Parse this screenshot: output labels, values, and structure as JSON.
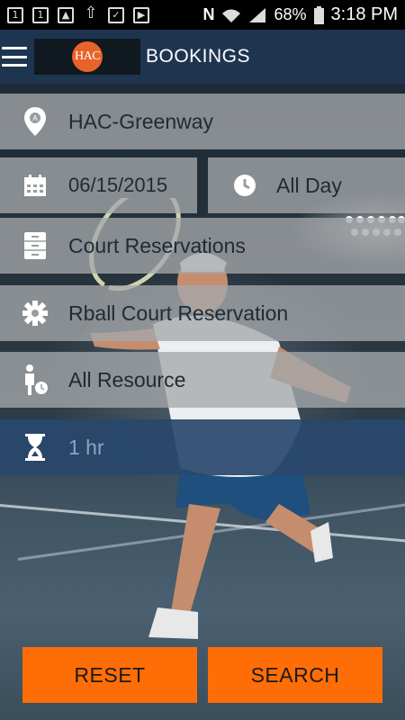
{
  "status_bar": {
    "notification_icons": [
      "calendar-1-icon",
      "calendar-1-icon",
      "image-icon",
      "upload-icon",
      "clipboard-check-icon",
      "play-icon"
    ],
    "battery": "68%",
    "time": "3:18 PM"
  },
  "app_bar": {
    "logo_text": "HAC",
    "title": "BOOKINGS"
  },
  "form": {
    "location": "HAC-Greenway",
    "date": "06/15/2015",
    "time": "All Day",
    "category": "Court Reservations",
    "reservation_type": "Rball Court Reservation",
    "resource": "All Resource",
    "duration": "1 hr"
  },
  "buttons": {
    "reset": "RESET",
    "search": "SEARCH"
  },
  "colors": {
    "accent": "#ff6e06",
    "app_bar": "#1e3550",
    "active_row": "#29486c",
    "row": "#a5a8aa"
  }
}
